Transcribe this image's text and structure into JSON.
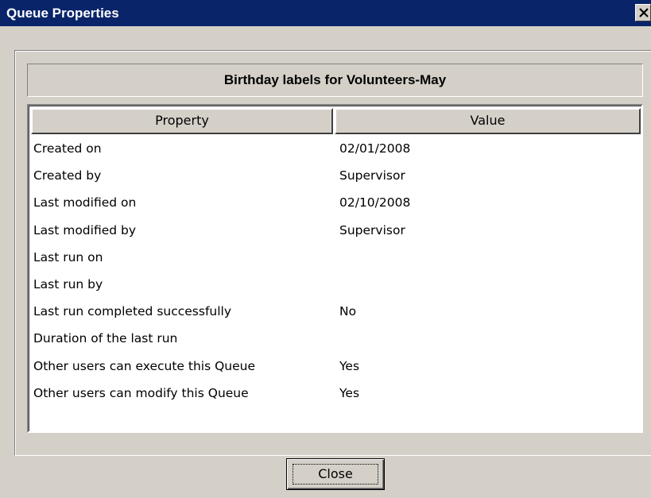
{
  "window": {
    "title": "Queue Properties"
  },
  "titlebar": {
    "close_icon": "close-icon"
  },
  "header": {
    "queue_name": "Birthday labels for Volunteers-May"
  },
  "table": {
    "columns": [
      "Property",
      "Value"
    ],
    "rows": [
      {
        "property": "Created on",
        "value": "02/01/2008"
      },
      {
        "property": "Created by",
        "value": "Supervisor"
      },
      {
        "property": "Last modified on",
        "value": "02/10/2008"
      },
      {
        "property": "Last modified by",
        "value": "Supervisor"
      },
      {
        "property": "Last run on",
        "value": ""
      },
      {
        "property": "Last run by",
        "value": ""
      },
      {
        "property": "Last run completed successfully",
        "value": "No"
      },
      {
        "property": "Duration of the last run",
        "value": ""
      },
      {
        "property": "Other users can execute this Queue",
        "value": "Yes"
      },
      {
        "property": "Other users can modify this Queue",
        "value": "Yes"
      }
    ]
  },
  "footer": {
    "close_label": "Close"
  },
  "colors": {
    "titlebar": "#0a246a",
    "face": "#d4d0c8",
    "list_background": "#ffffff"
  }
}
